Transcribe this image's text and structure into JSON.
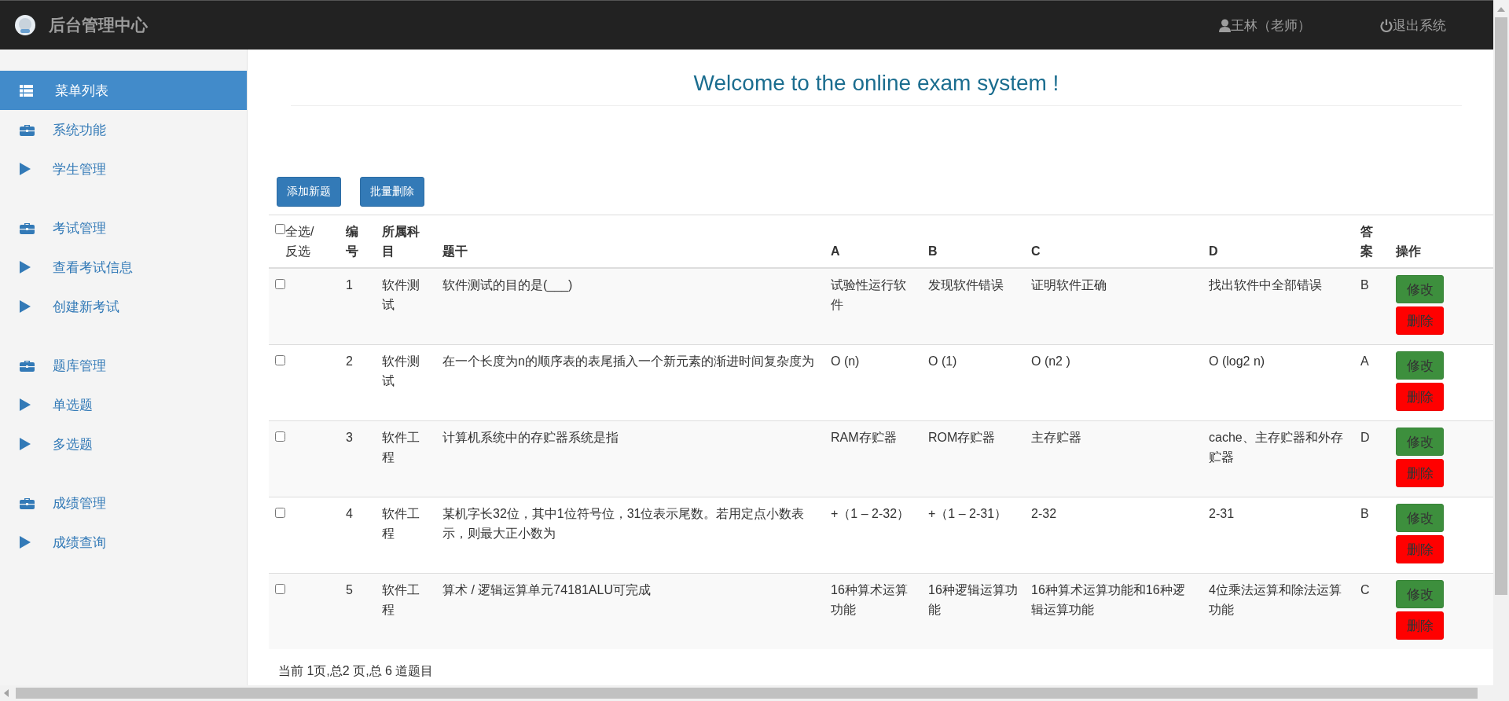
{
  "header": {
    "title": "后台管理中心",
    "user": "王林（老师）",
    "logout": "退出系统"
  },
  "sidebar": {
    "items": [
      {
        "kind": "menu",
        "label": "菜单列表",
        "selected": true
      },
      {
        "kind": "group",
        "label": "系统功能",
        "selected": false,
        "children": [
          {
            "kind": "link",
            "label": "学生管理",
            "selected": false
          }
        ]
      },
      {
        "kind": "group",
        "label": "考试管理",
        "selected": false,
        "children": [
          {
            "kind": "link",
            "label": "查看考试信息",
            "selected": false
          },
          {
            "kind": "link",
            "label": "创建新考试",
            "selected": false
          }
        ]
      },
      {
        "kind": "group",
        "label": "题库管理",
        "selected": false,
        "children": [
          {
            "kind": "link",
            "label": "单选题",
            "selected": false
          },
          {
            "kind": "link",
            "label": "多选题",
            "selected": false
          }
        ]
      },
      {
        "kind": "group",
        "label": "成绩管理",
        "selected": false,
        "children": [
          {
            "kind": "link",
            "label": "成绩查询",
            "selected": false
          }
        ]
      }
    ]
  },
  "welcome": "Welcome to the online exam system !",
  "toolbar": {
    "buttons": [
      "添加新题",
      "批量删除"
    ]
  },
  "table": {
    "select_all": {
      "label": "全选/反选",
      "checked": false
    },
    "columns": [
      "编号",
      "所属科目",
      "题干",
      "A",
      "B",
      "C",
      "D",
      "答案",
      "操作"
    ],
    "rows": [
      {
        "checked": false,
        "id": "1",
        "subject": "软件测试",
        "stem": "软件测试的目的是(___)",
        "a": "试验性运行软件",
        "b": "发现软件错误",
        "c": "证明软件正确",
        "d": "找出软件中全部错误",
        "answer": "B",
        "actions": [
          {
            "kind": "edit",
            "label": "修改"
          },
          {
            "kind": "delete",
            "label": "删除"
          }
        ]
      },
      {
        "checked": false,
        "id": "2",
        "subject": "软件测试",
        "stem": "在一个长度为n的顺序表的表尾插入一个新元素的渐进时间复杂度为",
        "a": "O (n)",
        "b": "O (1)",
        "c": "O (n2 )",
        "d": "O (log2 n)",
        "answer": "A",
        "actions": [
          {
            "kind": "edit",
            "label": "修改"
          },
          {
            "kind": "delete",
            "label": "删除"
          }
        ]
      },
      {
        "checked": false,
        "id": "3",
        "subject": "软件工程",
        "stem": "计算机系统中的存贮器系统是指",
        "a": "RAM存贮器",
        "b": "ROM存贮器",
        "c": "主存贮器",
        "d": "cache、主存贮器和外存贮器",
        "answer": "D",
        "actions": [
          {
            "kind": "edit",
            "label": "修改"
          },
          {
            "kind": "delete",
            "label": "删除"
          }
        ]
      },
      {
        "checked": false,
        "id": "4",
        "subject": "软件工程",
        "stem": "某机字长32位，其中1位符号位，31位表示尾数。若用定点小数表示，则最大正小数为",
        "a": "+（1 – 2-32）",
        "b": "+（1 – 2-31）",
        "c": "2-32",
        "d": "2-31",
        "answer": "B",
        "actions": [
          {
            "kind": "edit",
            "label": "修改"
          },
          {
            "kind": "delete",
            "label": "删除"
          }
        ]
      },
      {
        "checked": false,
        "id": "5",
        "subject": "软件工程",
        "stem": "算术 / 逻辑运算单元74181ALU可完成",
        "a": "16种算术运算功能",
        "b": "16种逻辑运算功能",
        "c": "16种算术运算功能和16种逻辑运算功能",
        "d": "4位乘法运算和除法运算功能",
        "answer": "C",
        "actions": [
          {
            "kind": "edit",
            "label": "修改"
          },
          {
            "kind": "delete",
            "label": "删除"
          }
        ]
      }
    ]
  },
  "pagination": "当前 1页,总2 页,总 6 道题目"
}
